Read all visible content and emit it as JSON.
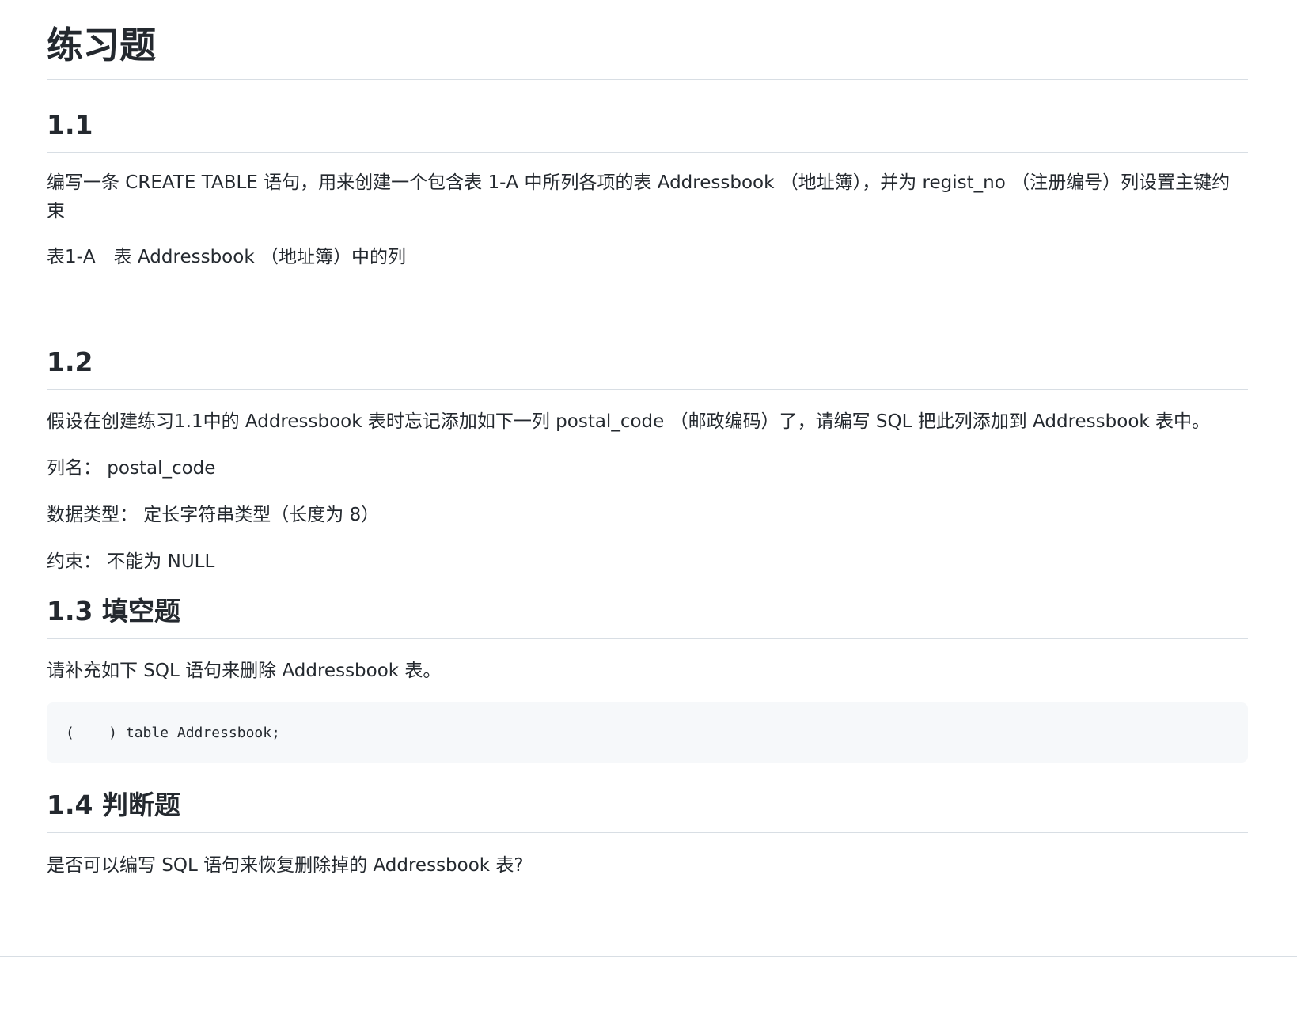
{
  "page_title": "练习题",
  "sections": [
    {
      "heading": "1.1",
      "paragraphs": [
        "编写一条 CREATE TABLE 语句，用来创建一个包含表 1-A 中所列各项的表 Addressbook （地址簿），并为 regist_no （注册编号）列设置主键约束",
        "表1-A　表 Addressbook （地址簿）中的列"
      ]
    },
    {
      "heading": "1.2",
      "paragraphs": [
        "假设在创建练习1.1中的 Addressbook 表时忘记添加如下一列 postal_code （邮政编码）了，请编写 SQL 把此列添加到 Addressbook 表中。",
        "列名： postal_code",
        "数据类型： 定长字符串类型（长度为 8）",
        "约束： 不能为 NULL"
      ]
    },
    {
      "heading": "1.3 填空题",
      "paragraphs": [
        "请补充如下 SQL 语句来删除 Addressbook 表。"
      ],
      "code": "(    ) table Addressbook;"
    },
    {
      "heading": "1.4 判断题",
      "paragraphs": [
        "是否可以编写 SQL 语句来恢复删除掉的 Addressbook 表?"
      ]
    }
  ]
}
